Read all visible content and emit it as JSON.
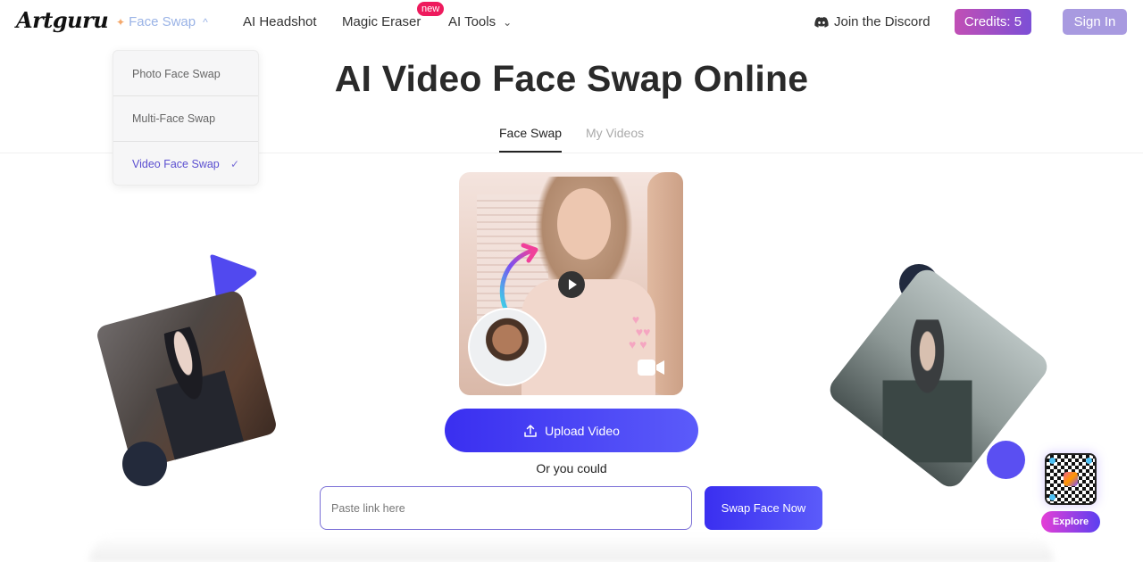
{
  "nav": {
    "logo": "Artguru",
    "items": [
      {
        "label": "Face Swap",
        "icon": "sparkle-icon",
        "expanded": true
      },
      {
        "label": "AI Headshot"
      },
      {
        "label": "Magic Eraser",
        "badge": "new"
      },
      {
        "label": "AI Tools",
        "icon": "chevron-down-icon"
      }
    ],
    "discord_label": "Join the Discord",
    "credits_label": "Credits: 5",
    "signin_label": "Sign In"
  },
  "dropdown": {
    "items": [
      {
        "label": "Photo Face Swap",
        "selected": false
      },
      {
        "label": "Multi-Face Swap",
        "selected": false
      },
      {
        "label": "Video Face Swap",
        "selected": true
      }
    ],
    "check_glyph": "✓"
  },
  "main": {
    "title": "AI Video Face Swap Online",
    "tabs": [
      {
        "label": "Face Swap",
        "active": true
      },
      {
        "label": "My Videos",
        "active": false
      }
    ],
    "upload_label": "Upload Video",
    "or_text": "Or you could",
    "link_placeholder": "Paste link here",
    "link_value": "",
    "swap_label": "Swap Face Now"
  },
  "widget": {
    "explore_label": "Explore"
  },
  "colors": {
    "accent": "#4a3ff3",
    "credits_gradient_start": "#c14fb5",
    "credits_gradient_end": "#7c4fd6",
    "signin": "#a89ae0",
    "new_badge": "#ee1a5d",
    "dropdown_selected": "#5b4fd0"
  }
}
